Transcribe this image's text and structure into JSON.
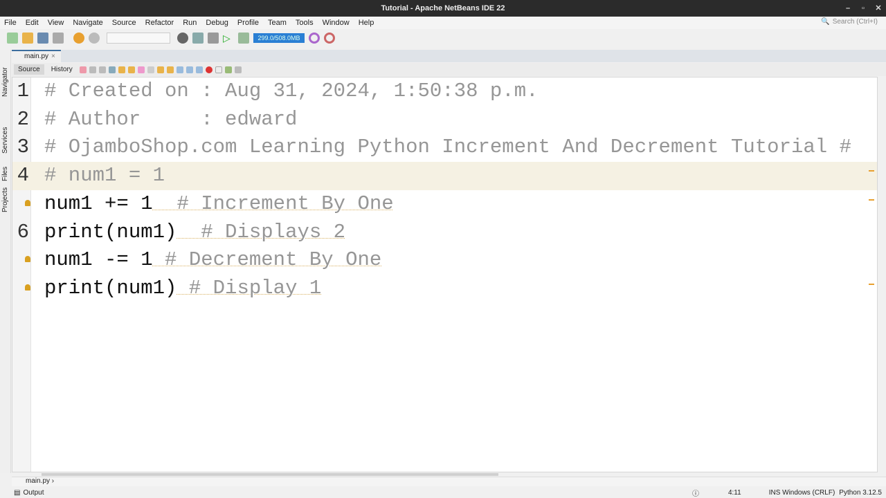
{
  "window": {
    "title": "Tutorial - Apache NetBeans IDE 22"
  },
  "menu": [
    "File",
    "Edit",
    "View",
    "Navigate",
    "Source",
    "Refactor",
    "Run",
    "Debug",
    "Profile",
    "Team",
    "Tools",
    "Window",
    "Help"
  ],
  "search": {
    "placeholder": "Search (Ctrl+I)"
  },
  "toolbar": {
    "memory": "299.0/508.0MB"
  },
  "tab": {
    "label": "main.py",
    "close": "×"
  },
  "editor_toolbar": {
    "source": "Source",
    "history": "History"
  },
  "side_tabs": [
    "Navigator",
    "Services",
    "Files",
    "Projects"
  ],
  "code": [
    {
      "num": "1",
      "text": "# Created on : Aug 31, 2024, 1:50:38 p.m."
    },
    {
      "num": "2",
      "text": "# Author     : edward"
    },
    {
      "num": "3",
      "text": "# OjamboShop.com Learning Python Increment And Decrement Tutorial #"
    },
    {
      "num": "4",
      "text": "# num1 = 1"
    },
    {
      "num": "",
      "code": "num1 += 1",
      "comment": "  # Increment By One"
    },
    {
      "num": "6",
      "code": "print(num1)",
      "comment": "  # Displays 2"
    },
    {
      "num": "",
      "code": "num1 -= 1",
      "comment": " # Decrement By One"
    },
    {
      "num": "",
      "code": "print(num1)",
      "comment": " # Display 1"
    }
  ],
  "breadcrumb": "main.py",
  "status": {
    "output": "Output",
    "position": "4:11",
    "mode": "INS Windows (CRLF)",
    "python": "Python 3.12.5"
  }
}
